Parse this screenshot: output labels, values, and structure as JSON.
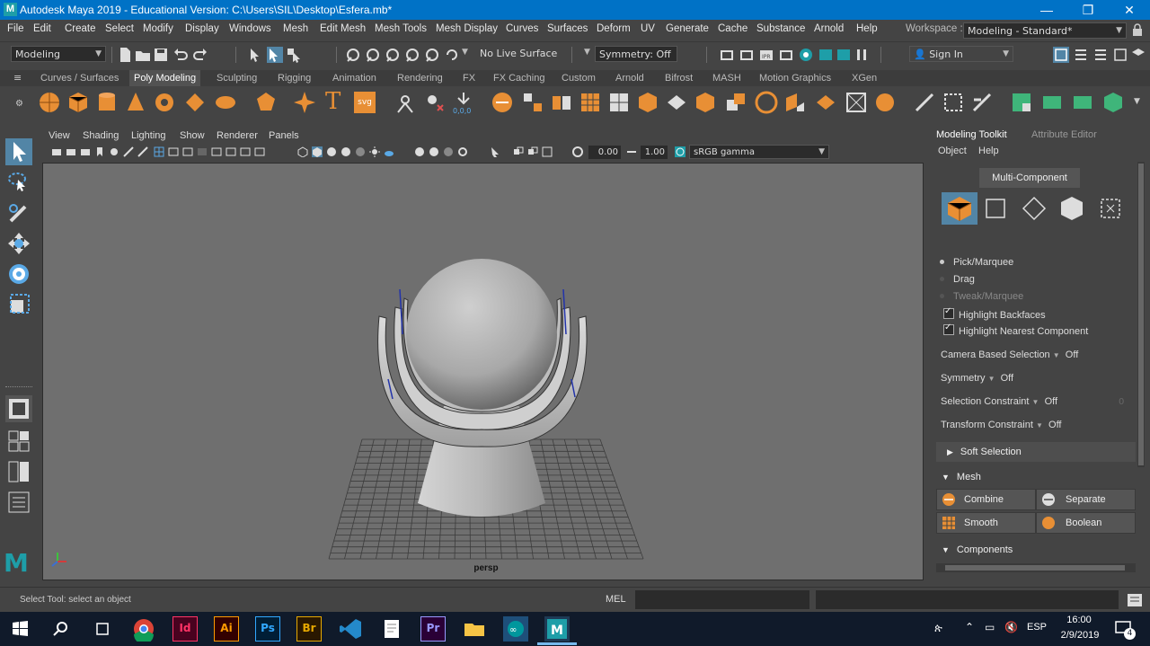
{
  "window": {
    "title": "Autodesk Maya 2019 - Educational Version: C:\\Users\\SIL\\Desktop\\Esfera.mb*",
    "minimize": "—",
    "maximize": "❐",
    "close": "✕"
  },
  "menubar": {
    "items": [
      "File",
      "Edit",
      "Create",
      "Select",
      "Modify",
      "Display",
      "Windows",
      "Mesh",
      "Edit Mesh",
      "Mesh Tools",
      "Mesh Display",
      "Curves",
      "Surfaces",
      "Deform",
      "UV",
      "Generate",
      "Cache",
      "Substance",
      "Arnold",
      "Help"
    ],
    "workspace_label": "Workspace :",
    "workspace_value": "Modeling - Standard*"
  },
  "statusline": {
    "mode": "Modeling",
    "live_surface": "No Live Surface",
    "symmetry": "Symmetry: Off",
    "sign_in": "Sign In"
  },
  "shelf": {
    "tabs": [
      "Curves / Surfaces",
      "Poly Modeling",
      "Sculpting",
      "Rigging",
      "Animation",
      "Rendering",
      "FX",
      "FX Caching",
      "Custom",
      "Arnold",
      "Bifrost",
      "MASH",
      "Motion Graphics",
      "XGen"
    ],
    "active": "Poly Modeling",
    "text_tool": "T",
    "svg_tool": "svg"
  },
  "viewport": {
    "menus": [
      "View",
      "Shading",
      "Lighting",
      "Show",
      "Renderer",
      "Panels"
    ],
    "exposure": "0.00",
    "gamma": "1.00",
    "color_space": "sRGB gamma",
    "camera_label": "persp"
  },
  "toolkit": {
    "tabs": [
      "Modeling Toolkit",
      "Attribute Editor"
    ],
    "submenu": [
      "Object",
      "Help"
    ],
    "mode_button": "Multi-Component",
    "pick_modes": [
      "Pick/Marquee",
      "Drag",
      "Tweak/Marquee"
    ],
    "highlight_backfaces": "Highlight Backfaces",
    "highlight_nearest": "Highlight Nearest Component",
    "camera_based_selection": {
      "label": "Camera Based Selection",
      "value": "Off"
    },
    "symmetry": {
      "label": "Symmetry",
      "value": "Off"
    },
    "selection_constraint": {
      "label": "Selection Constraint",
      "value": "Off",
      "count": "0"
    },
    "transform_constraint": {
      "label": "Transform Constraint",
      "value": "Off"
    },
    "soft_selection": "Soft Selection",
    "mesh_section": "Mesh",
    "mesh_buttons": [
      "Combine",
      "Separate",
      "Smooth",
      "Boolean"
    ],
    "components_section": "Components"
  },
  "commandline": {
    "help_text": "Select Tool: select an object",
    "lang": "MEL"
  },
  "taskbar": {
    "lang": "ESP",
    "time": "16:00",
    "date": "2/9/2019",
    "notifications": "4",
    "apps": [
      "Id",
      "Ai",
      "Ps",
      "Br",
      "Pr"
    ]
  },
  "colors": {
    "accent": "#0072c6",
    "maya_teal": "#1e9ea8",
    "shelf_orange": "#e88f35",
    "highlight_blue": "#5285a6"
  }
}
